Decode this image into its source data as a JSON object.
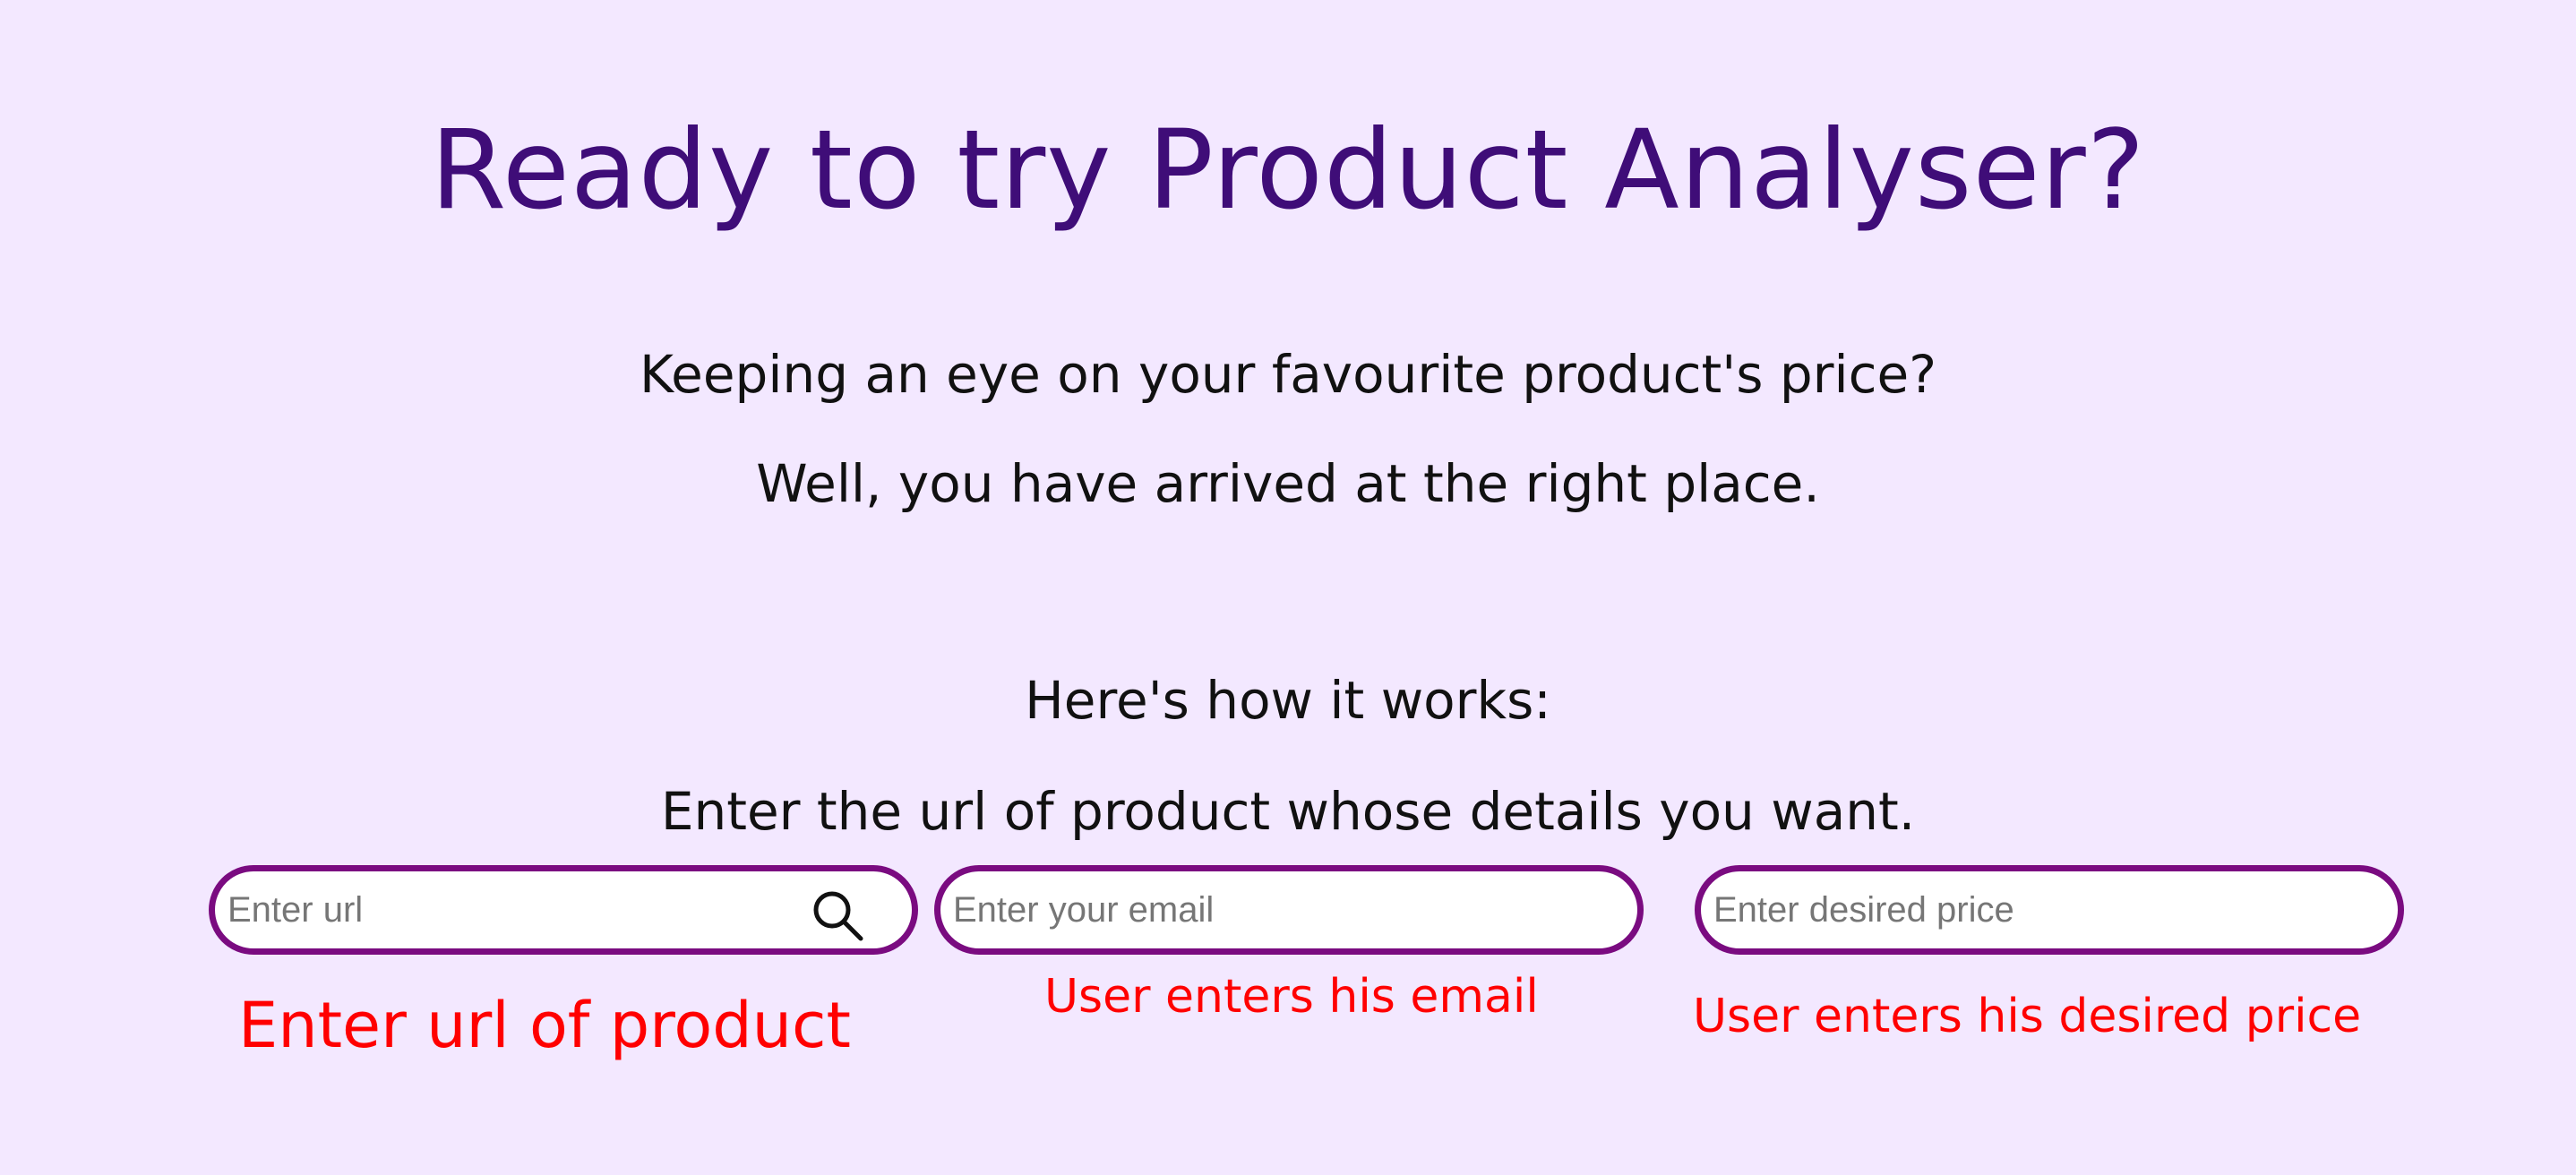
{
  "hero": {
    "title": "Ready to try Product Analyser?",
    "intro_line_1": "Keeping an eye on your favourite product's price?",
    "intro_line_2": "Well, you have arrived at the right place.",
    "how_it_works": "Here's how it works:",
    "instruction": "Enter the url of product whose details you want."
  },
  "form": {
    "url_placeholder": "Enter url",
    "email_placeholder": "Enter your email",
    "price_placeholder": "Enter desired price",
    "search_icon": "search-icon"
  },
  "hints": {
    "url": "Enter url of product",
    "email": "User enters his email",
    "price": "User enters his desired price"
  },
  "colors": {
    "background": "#f3e8ff",
    "title": "#3f0d78",
    "field_border": "#7a0b80",
    "hint_text": "#ff0000"
  }
}
